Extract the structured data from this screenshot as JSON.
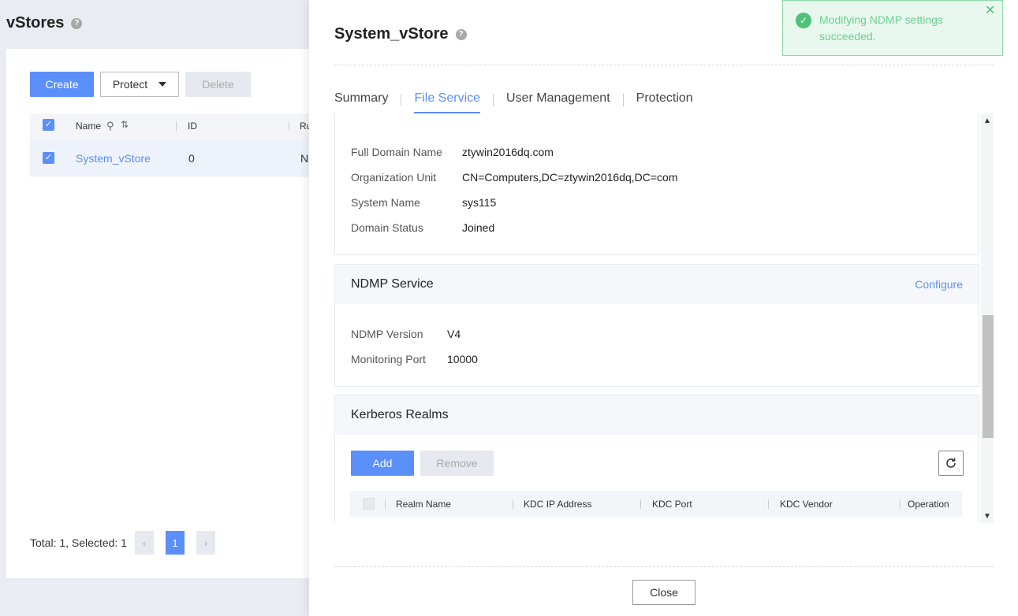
{
  "background": {
    "title": "vStores",
    "create_label": "Create",
    "protect_label": "Protect",
    "delete_label": "Delete",
    "columns": {
      "name": "Name",
      "id": "ID",
      "ru": "Ru"
    },
    "row": {
      "name": "System_vStore",
      "id": "0",
      "ru": "N"
    },
    "pager": {
      "info": "Total: 1, Selected: 1",
      "current": "1",
      "prev": "‹",
      "next": "›"
    }
  },
  "drawer": {
    "title": "System_vStore",
    "tabs": [
      {
        "label": "Summary"
      },
      {
        "label": "File Service"
      },
      {
        "label": "User Management"
      },
      {
        "label": "Protection"
      }
    ],
    "active_tab": "File Service",
    "domain": {
      "full_domain_name_label": "Full Domain Name",
      "full_domain_name": "ztywin2016dq.com",
      "org_unit_label": "Organization Unit",
      "org_unit": "CN=Computers,DC=ztywin2016dq,DC=com",
      "system_name_label": "System Name",
      "system_name": "sys115",
      "domain_status_label": "Domain Status",
      "domain_status": "Joined"
    },
    "ndmp": {
      "title": "NDMP Service",
      "configure_label": "Configure",
      "version_label": "NDMP Version",
      "version": "V4",
      "port_label": "Monitoring Port",
      "port": "10000"
    },
    "kerberos": {
      "title": "Kerberos Realms",
      "add_label": "Add",
      "remove_label": "Remove",
      "columns": [
        "Realm Name",
        "KDC IP Address",
        "KDC Port",
        "KDC Vendor",
        "Operation"
      ]
    },
    "close_label": "Close"
  },
  "toast": {
    "message": "Modifying NDMP settings succeeded.",
    "status_color": "#4fc27a"
  },
  "colors": {
    "accent": "#5b8ff9",
    "success": "#4fc27a"
  }
}
